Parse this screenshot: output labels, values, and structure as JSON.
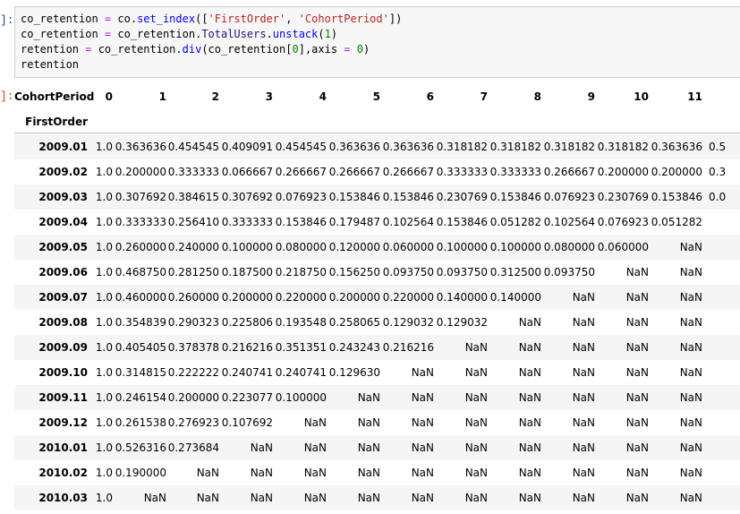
{
  "prompts": {
    "in": "]:",
    "out": "]:"
  },
  "code": {
    "lines": [
      [
        {
          "t": "co_retention ",
          "c": ""
        },
        {
          "t": "=",
          "c": "op"
        },
        {
          "t": " co.",
          "c": ""
        },
        {
          "t": "set_index",
          "c": "fn"
        },
        {
          "t": "([",
          "c": ""
        },
        {
          "t": "'FirstOrder'",
          "c": "str"
        },
        {
          "t": ", ",
          "c": ""
        },
        {
          "t": "'CohortPeriod'",
          "c": "str"
        },
        {
          "t": "])",
          "c": ""
        }
      ],
      [
        {
          "t": "co_retention ",
          "c": ""
        },
        {
          "t": "=",
          "c": "op"
        },
        {
          "t": " co_retention.",
          "c": ""
        },
        {
          "t": "TotalUsers",
          "c": "attr"
        },
        {
          "t": ".",
          "c": ""
        },
        {
          "t": "unstack",
          "c": "fn"
        },
        {
          "t": "(",
          "c": ""
        },
        {
          "t": "1",
          "c": "num"
        },
        {
          "t": ")",
          "c": ""
        }
      ],
      [
        {
          "t": "retention ",
          "c": ""
        },
        {
          "t": "=",
          "c": "op"
        },
        {
          "t": " co_retention.",
          "c": ""
        },
        {
          "t": "div",
          "c": "fn"
        },
        {
          "t": "(co_retention[",
          "c": ""
        },
        {
          "t": "0",
          "c": "num"
        },
        {
          "t": "],axis ",
          "c": ""
        },
        {
          "t": "=",
          "c": "op"
        },
        {
          "t": " ",
          "c": ""
        },
        {
          "t": "0",
          "c": "num"
        },
        {
          "t": ")",
          "c": ""
        }
      ],
      [
        {
          "t": "retention",
          "c": ""
        }
      ]
    ]
  },
  "table": {
    "columns_name": "CohortPeriod",
    "index_name": "FirstOrder",
    "columns": [
      "0",
      "1",
      "2",
      "3",
      "4",
      "5",
      "6",
      "7",
      "8",
      "9",
      "10",
      "11",
      ""
    ],
    "rows": [
      {
        "index": "2009.01",
        "cells": [
          "1.0",
          "0.363636",
          "0.454545",
          "0.409091",
          "0.454545",
          "0.363636",
          "0.363636",
          "0.318182",
          "0.318182",
          "0.318182",
          "0.318182",
          "0.363636",
          "0.5"
        ]
      },
      {
        "index": "2009.02",
        "cells": [
          "1.0",
          "0.200000",
          "0.333333",
          "0.066667",
          "0.266667",
          "0.266667",
          "0.266667",
          "0.333333",
          "0.333333",
          "0.266667",
          "0.200000",
          "0.200000",
          "0.3"
        ]
      },
      {
        "index": "2009.03",
        "cells": [
          "1.0",
          "0.307692",
          "0.384615",
          "0.307692",
          "0.076923",
          "0.153846",
          "0.153846",
          "0.230769",
          "0.153846",
          "0.076923",
          "0.230769",
          "0.153846",
          "0.0"
        ]
      },
      {
        "index": "2009.04",
        "cells": [
          "1.0",
          "0.333333",
          "0.256410",
          "0.333333",
          "0.153846",
          "0.179487",
          "0.102564",
          "0.153846",
          "0.051282",
          "0.102564",
          "0.076923",
          "0.051282",
          ""
        ]
      },
      {
        "index": "2009.05",
        "cells": [
          "1.0",
          "0.260000",
          "0.240000",
          "0.100000",
          "0.080000",
          "0.120000",
          "0.060000",
          "0.100000",
          "0.100000",
          "0.080000",
          "0.060000",
          "NaN",
          ""
        ]
      },
      {
        "index": "2009.06",
        "cells": [
          "1.0",
          "0.468750",
          "0.281250",
          "0.187500",
          "0.218750",
          "0.156250",
          "0.093750",
          "0.093750",
          "0.312500",
          "0.093750",
          "NaN",
          "NaN",
          ""
        ]
      },
      {
        "index": "2009.07",
        "cells": [
          "1.0",
          "0.460000",
          "0.260000",
          "0.200000",
          "0.220000",
          "0.200000",
          "0.220000",
          "0.140000",
          "0.140000",
          "NaN",
          "NaN",
          "NaN",
          ""
        ]
      },
      {
        "index": "2009.08",
        "cells": [
          "1.0",
          "0.354839",
          "0.290323",
          "0.225806",
          "0.193548",
          "0.258065",
          "0.129032",
          "0.129032",
          "NaN",
          "NaN",
          "NaN",
          "NaN",
          ""
        ]
      },
      {
        "index": "2009.09",
        "cells": [
          "1.0",
          "0.405405",
          "0.378378",
          "0.216216",
          "0.351351",
          "0.243243",
          "0.216216",
          "NaN",
          "NaN",
          "NaN",
          "NaN",
          "NaN",
          ""
        ]
      },
      {
        "index": "2009.10",
        "cells": [
          "1.0",
          "0.314815",
          "0.222222",
          "0.240741",
          "0.240741",
          "0.129630",
          "NaN",
          "NaN",
          "NaN",
          "NaN",
          "NaN",
          "NaN",
          ""
        ]
      },
      {
        "index": "2009.11",
        "cells": [
          "1.0",
          "0.246154",
          "0.200000",
          "0.223077",
          "0.100000",
          "NaN",
          "NaN",
          "NaN",
          "NaN",
          "NaN",
          "NaN",
          "NaN",
          ""
        ]
      },
      {
        "index": "2009.12",
        "cells": [
          "1.0",
          "0.261538",
          "0.276923",
          "0.107692",
          "NaN",
          "NaN",
          "NaN",
          "NaN",
          "NaN",
          "NaN",
          "NaN",
          "NaN",
          ""
        ]
      },
      {
        "index": "2010.01",
        "cells": [
          "1.0",
          "0.526316",
          "0.273684",
          "NaN",
          "NaN",
          "NaN",
          "NaN",
          "NaN",
          "NaN",
          "NaN",
          "NaN",
          "NaN",
          ""
        ]
      },
      {
        "index": "2010.02",
        "cells": [
          "1.0",
          "0.190000",
          "NaN",
          "NaN",
          "NaN",
          "NaN",
          "NaN",
          "NaN",
          "NaN",
          "NaN",
          "NaN",
          "NaN",
          ""
        ]
      },
      {
        "index": "2010.03",
        "cells": [
          "1.0",
          "NaN",
          "NaN",
          "NaN",
          "NaN",
          "NaN",
          "NaN",
          "NaN",
          "NaN",
          "NaN",
          "NaN",
          "NaN",
          ""
        ]
      }
    ]
  }
}
